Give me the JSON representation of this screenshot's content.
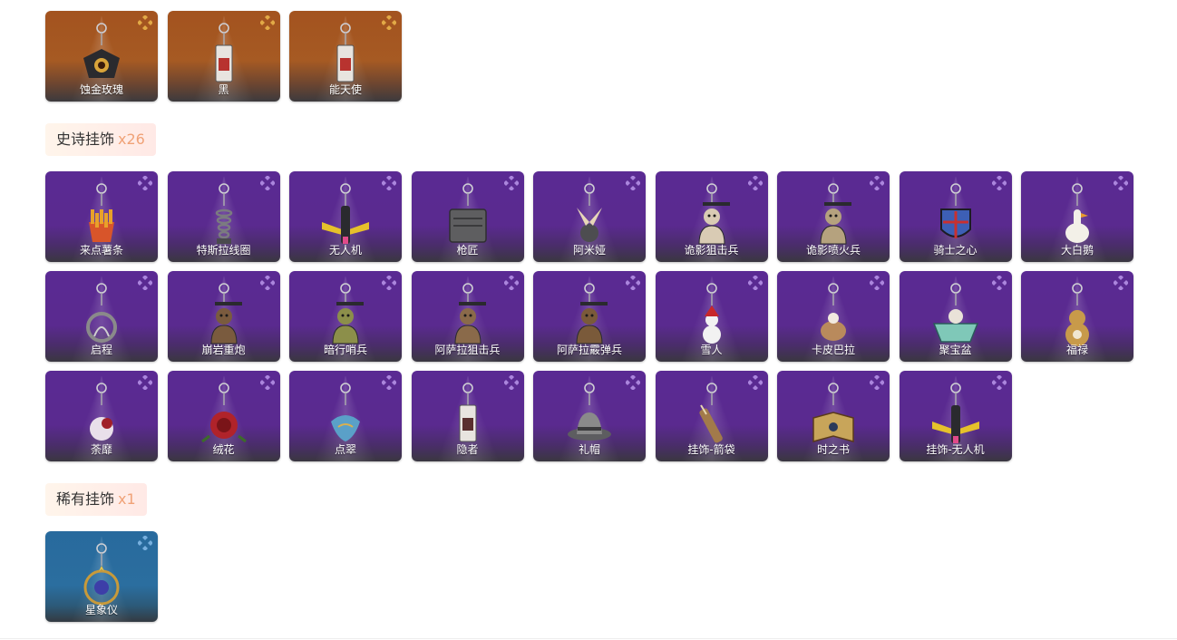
{
  "legendary_items": [
    {
      "name": "蚀金玫瑰",
      "icon": "lantern-charm-icon",
      "accent": "#d9a43a"
    },
    {
      "name": "黑",
      "icon": "tag-charm-icon",
      "accent": "#b8332f"
    },
    {
      "name": "能天使",
      "icon": "tag-charm-icon",
      "accent": "#b8332f"
    }
  ],
  "sections": {
    "epic": {
      "title": "史诗挂饰",
      "count": "x26"
    },
    "rare": {
      "title": "稀有挂饰",
      "count": "x1"
    }
  },
  "epic_items": [
    {
      "name": "来点薯条",
      "icon": "fries-charm-icon",
      "accent": "#e8a12a"
    },
    {
      "name": "特斯拉线圈",
      "icon": "coil-charm-icon",
      "accent": "#7b7b80"
    },
    {
      "name": "无人机",
      "icon": "drone-charm-icon",
      "accent": "#e6c12b"
    },
    {
      "name": "枪匠",
      "icon": "toolbox-charm-icon",
      "accent": "#6b6b6b"
    },
    {
      "name": "阿米娅",
      "icon": "bunny-charm-icon",
      "accent": "#e7d7b8"
    },
    {
      "name": "诡影狙击兵",
      "icon": "figure-charm-icon",
      "accent": "#d9cbb4"
    },
    {
      "name": "诡影喷火兵",
      "icon": "figure-charm-icon",
      "accent": "#b5a27e"
    },
    {
      "name": "骑士之心",
      "icon": "shield-charm-icon",
      "accent": "#3d5fb5"
    },
    {
      "name": "大白鹅",
      "icon": "goose-charm-icon",
      "accent": "#f3f0e8"
    },
    {
      "name": "启程",
      "icon": "ring-charm-icon",
      "accent": "#8a8a8a"
    },
    {
      "name": "崩岩重炮",
      "icon": "figure-charm-icon",
      "accent": "#7a5b3e"
    },
    {
      "name": "暗行哨兵",
      "icon": "figure-charm-icon",
      "accent": "#8c8f4a"
    },
    {
      "name": "阿萨拉狙击兵",
      "icon": "figure-charm-icon",
      "accent": "#8a6a4a"
    },
    {
      "name": "阿萨拉霰弹兵",
      "icon": "figure-charm-icon",
      "accent": "#7a5a3a"
    },
    {
      "name": "雪人",
      "icon": "snowman-charm-icon",
      "accent": "#f2f2f2"
    },
    {
      "name": "卡皮巴拉",
      "icon": "capybara-charm-icon",
      "accent": "#b98a5c"
    },
    {
      "name": "聚宝盆",
      "icon": "treasure-bowl-charm-icon",
      "accent": "#7fc8b8"
    },
    {
      "name": "福禄",
      "icon": "gourd-charm-icon",
      "accent": "#c89a4a"
    },
    {
      "name": "荼靡",
      "icon": "flower-charm-icon",
      "accent": "#e9e0ea"
    },
    {
      "name": "绒花",
      "icon": "rose-charm-icon",
      "accent": "#b0232a"
    },
    {
      "name": "点翠",
      "icon": "bird-charm-icon",
      "accent": "#5aa0c8"
    },
    {
      "name": "隐者",
      "icon": "tag-charm-icon",
      "accent": "#5a2f2f"
    },
    {
      "name": "礼帽",
      "icon": "hat-charm-icon",
      "accent": "#8a8a8a"
    },
    {
      "name": "挂饰-箭袋",
      "icon": "quiver-charm-icon",
      "accent": "#a27a4a"
    },
    {
      "name": "时之书",
      "icon": "book-charm-icon",
      "accent": "#c8a55a"
    },
    {
      "name": "挂饰-无人机",
      "icon": "drone-charm-icon",
      "accent": "#e6c12b"
    }
  ],
  "rare_items": [
    {
      "name": "星象仪",
      "icon": "astrolabe-charm-icon",
      "accent": "#c89a3a"
    }
  ],
  "colors": {
    "legendary": "#a3531f",
    "epic": "#5a2a93",
    "rare": "#286a9d",
    "count_text": "#f0a277"
  }
}
